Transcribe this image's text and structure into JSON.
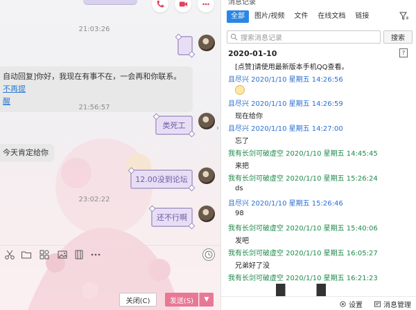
{
  "chat": {
    "times": [
      "21:03:26",
      "21:56:57",
      "23:02:22"
    ],
    "auto_reply": {
      "line1": "自动回复]你好，我现在有事不在，一会再和你联系。",
      "link1": "不再提",
      "link2": "醒"
    },
    "left_message": "今天肯定给你",
    "sent_messages": [
      "",
      "类死工",
      "12.00没到论坛",
      "还不行啊"
    ],
    "buttons": {
      "close": "关闭(C)",
      "send": "发送(S)"
    }
  },
  "history": {
    "title": "消息记录",
    "tabs": [
      "全部",
      "图片/视频",
      "文件",
      "在线文档",
      "链接"
    ],
    "search_placeholder": "搜索消息记录",
    "search_button": "搜索",
    "date": "2020-01-10",
    "entries": [
      {
        "type": "text",
        "text": "[点赞]请使用最新版本手机QQ查看。"
      },
      {
        "type": "sender",
        "color": "blue",
        "text": "且尽兴 2020/1/10 星期五 14:26:56"
      },
      {
        "type": "emoji"
      },
      {
        "type": "sender",
        "color": "blue",
        "text": "且尽兴 2020/1/10 星期五 14:26:59"
      },
      {
        "type": "text",
        "text": "现在给你"
      },
      {
        "type": "sender",
        "color": "blue",
        "text": "且尽兴 2020/1/10 星期五 14:27:00"
      },
      {
        "type": "text",
        "text": "忘了"
      },
      {
        "type": "sender",
        "color": "green",
        "text": "我有长剑可破虚空 2020/1/10 星期五 14:45:45"
      },
      {
        "type": "text",
        "text": "来把"
      },
      {
        "type": "sender",
        "color": "green",
        "text": "我有长剑可破虚空 2020/1/10 星期五 15:26:24"
      },
      {
        "type": "text",
        "text": "ds"
      },
      {
        "type": "sender",
        "color": "blue",
        "text": "且尽兴 2020/1/10 星期五 15:26:46"
      },
      {
        "type": "text",
        "text": "98"
      },
      {
        "type": "sender",
        "color": "green",
        "text": "我有长剑可破虚空 2020/1/10 星期五 15:40:06"
      },
      {
        "type": "text",
        "text": "发吧"
      },
      {
        "type": "sender",
        "color": "green",
        "text": "我有长剑可破虚空 2020/1/10 星期五 16:05:27"
      },
      {
        "type": "text",
        "text": "兄弟好了没"
      },
      {
        "type": "sender",
        "color": "green",
        "text": "我有长剑可破虚空 2020/1/10 星期五 16:21:23"
      }
    ],
    "bottom": {
      "settings": "设置",
      "manage": "消息管理"
    }
  }
}
